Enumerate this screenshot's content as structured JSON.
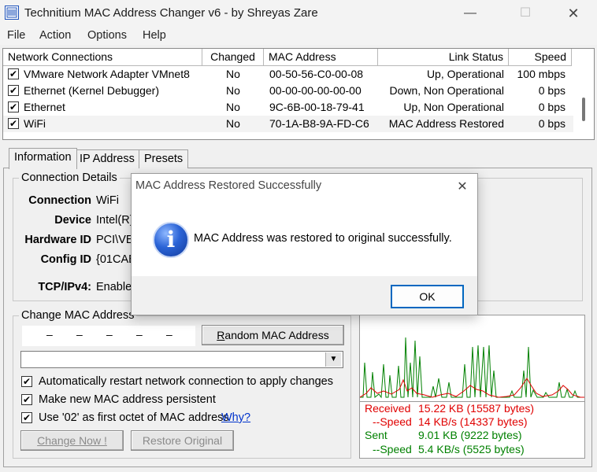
{
  "window": {
    "title": "Technitium MAC Address Changer v6 - by Shreyas Zare",
    "minimize": "—",
    "maximize": "☐",
    "close": "✕"
  },
  "menu": [
    "File",
    "Action",
    "Options",
    "Help"
  ],
  "connections": {
    "columns": [
      "Network Connections",
      "Changed",
      "MAC Address",
      "Link Status",
      "Speed"
    ],
    "rows": [
      {
        "checked": "✔",
        "name": "VMware Network Adapter VMnet8",
        "changed": "No",
        "mac": "00-50-56-C0-00-08",
        "status": "Up, Operational",
        "speed": "100 mbps"
      },
      {
        "checked": "✔",
        "name": "Ethernet (Kernel Debugger)",
        "changed": "No",
        "mac": "00-00-00-00-00-00",
        "status": "Down, Non Operational",
        "speed": "0 bps"
      },
      {
        "checked": "✔",
        "name": "Ethernet",
        "changed": "No",
        "mac": "9C-6B-00-18-79-41",
        "status": "Up, Non Operational",
        "speed": "0 bps"
      },
      {
        "checked": "✔",
        "name": "WiFi",
        "changed": "No",
        "mac": "70-1A-B8-9A-FD-C6",
        "status": "MAC Address Restored",
        "speed": "0 bps"
      }
    ]
  },
  "tabs": [
    "Information",
    "IP Address",
    "Presets"
  ],
  "connection_details": {
    "title": "Connection Details",
    "fields": [
      {
        "label": "Connection",
        "value": "WiFi"
      },
      {
        "label": "Device",
        "value": "Intel(R)"
      },
      {
        "label": "Hardware ID",
        "value": "PCI\\VE"
      },
      {
        "label": "Config ID",
        "value": "{01CAE"
      },
      {
        "label": "TCP/IPv4:",
        "value": "Enable"
      }
    ]
  },
  "change_mac": {
    "title": "Change MAC Address",
    "octet_separators": [
      "–",
      "–",
      "–",
      "–",
      "–"
    ],
    "random_button": "Random MAC Address",
    "dropdown_arrow": "▼",
    "options": [
      {
        "checked": "✔",
        "label": "Automatically restart network connection to apply changes"
      },
      {
        "checked": "✔",
        "label": "Make new MAC address persistent"
      },
      {
        "checked": "✔",
        "label": "Use '02' as first octet of MAC address"
      }
    ],
    "why_link": "Why?",
    "change_now_button": "Change Now !",
    "restore_button": "Restore Original"
  },
  "traffic": {
    "received_label": "Received",
    "received_value": "15.22 KB (15587 bytes)",
    "received_speed_label": "--Speed",
    "received_speed_value": "14 KB/s (14337 bytes)",
    "sent_label": "Sent",
    "sent_value": "9.01 KB (9222 bytes)",
    "sent_speed_label": "--Speed",
    "sent_speed_value": "5.4 KB/s (5525 bytes)",
    "colors": {
      "received": "#e00000",
      "sent": "#008000"
    }
  },
  "dialog": {
    "title": "MAC Address Restored Successfully",
    "close": "✕",
    "message": "MAC Address was restored to original successfully.",
    "icon_glyph": "i",
    "ok_button": "OK"
  }
}
